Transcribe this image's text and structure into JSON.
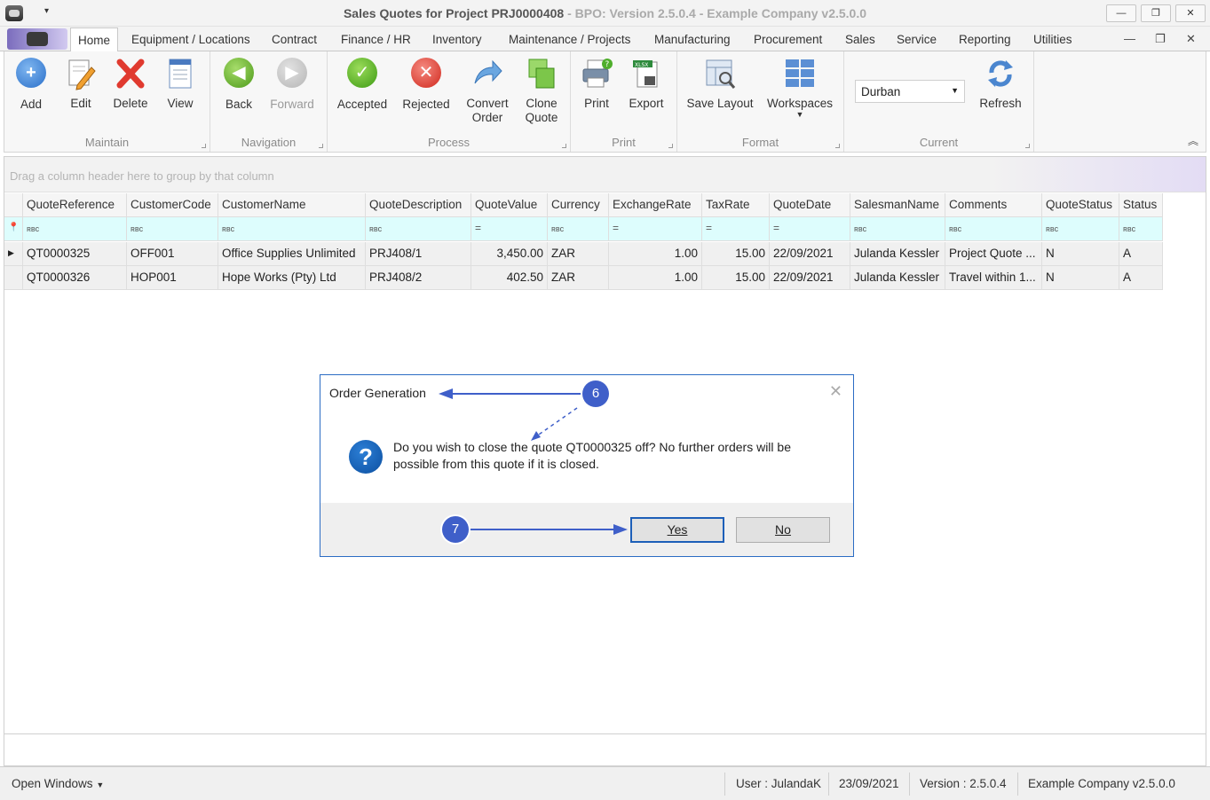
{
  "window": {
    "title_main": "Sales Quotes for Project PRJ0000408",
    "title_sub": " - BPO: Version 2.5.0.4 - Example Company v2.5.0.0",
    "qat_arrow": "▾",
    "minimize": "—",
    "maximize": "❐",
    "close": "✕"
  },
  "tabs": [
    "Home",
    "Equipment / Locations",
    "Contract",
    "Finance / HR",
    "Inventory",
    "Maintenance / Projects",
    "Manufacturing",
    "Procurement",
    "Sales",
    "Service",
    "Reporting",
    "Utilities"
  ],
  "mdi": {
    "minimize": "—",
    "restore": "❐",
    "close": "✕"
  },
  "ribbon": {
    "groups": {
      "maintain": "Maintain",
      "navigation": "Navigation",
      "process": "Process",
      "print": "Print",
      "format": "Format",
      "current": "Current"
    },
    "buttons": {
      "add": "Add",
      "edit": "Edit",
      "delete": "Delete",
      "view": "View",
      "back": "Back",
      "forward": "Forward",
      "accepted": "Accepted",
      "rejected": "Rejected",
      "convert_1": "Convert",
      "convert_2": "Order",
      "clone_1": "Clone",
      "clone_2": "Quote",
      "print": "Print",
      "export": "Export",
      "save_layout": "Save Layout",
      "workspaces": "Workspaces",
      "refresh": "Refresh"
    },
    "current_site": "Durban",
    "collapse": "︽"
  },
  "grid": {
    "group_hint": "Drag a column header here to group by that column",
    "columns": [
      "QuoteReference",
      "CustomerCode",
      "CustomerName",
      "QuoteDescription",
      "QuoteValue",
      "Currency",
      "ExchangeRate",
      "TaxRate",
      "QuoteDate",
      "SalesmanName",
      "Comments",
      "QuoteStatus",
      "Status"
    ],
    "filter_text": "ʀʙᴄ",
    "filter_eq": "=",
    "rows": [
      [
        "QT0000325",
        "OFF001",
        "Office Supplies Unlimited",
        "PRJ408/1",
        "3,450.00",
        "ZAR",
        "1.00",
        "15.00",
        "22/09/2021",
        "Julanda Kessler",
        "Project Quote ...",
        "N",
        "A"
      ],
      [
        "QT0000326",
        "HOP001",
        "Hope Works (Pty) Ltd",
        "PRJ408/2",
        "402.50",
        "ZAR",
        "1.00",
        "15.00",
        "22/09/2021",
        "Julanda Kessler",
        "Travel within 1...",
        "N",
        "A"
      ]
    ]
  },
  "dialog": {
    "title": "Order Generation",
    "message": "Do you wish to close the quote QT0000325 off? No further orders will be possible from this quote if it is closed.",
    "yes": "Yes",
    "no": "No",
    "close": "✕"
  },
  "annotations": {
    "step_6": "6",
    "step_7": "7"
  },
  "statusbar": {
    "open_windows": "Open Windows",
    "user": "User : JulandaK",
    "date": "23/09/2021",
    "version": "Version : 2.5.0.4",
    "company": "Example Company v2.5.0.0"
  }
}
